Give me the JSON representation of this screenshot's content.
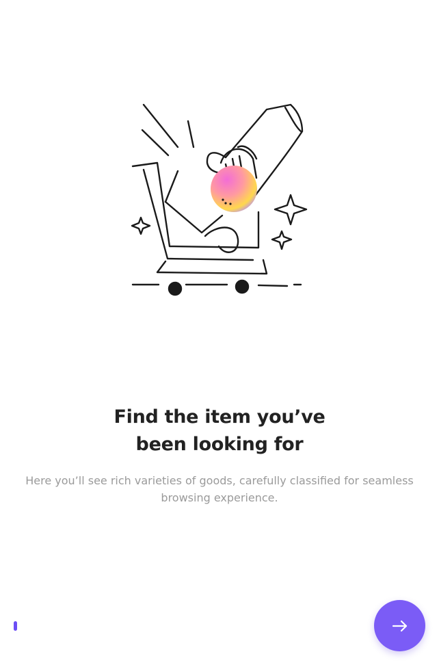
{
  "onboarding": {
    "illustration": {
      "icon": "shopping-cart-hand-illustration"
    },
    "title_line1": "Find the item you’ve",
    "title_line2": "been looking for",
    "subtitle": "Here you’ll see rich varieties of goods, carefully classified for seamless browsing experience.",
    "page_indicator": {
      "active_index": 0,
      "color": "#6C4EF5"
    },
    "next_button": {
      "icon": "arrow-right-icon",
      "color": "#7B5CF6"
    }
  }
}
